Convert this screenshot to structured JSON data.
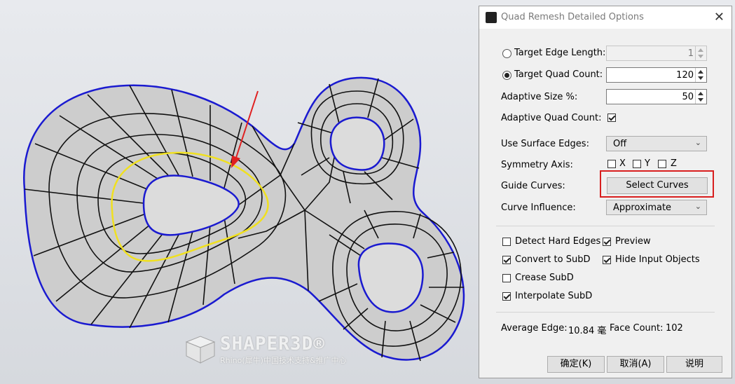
{
  "dialog": {
    "title": "Quad Remesh Detailed Options",
    "close_glyph": "✕",
    "target_edge_length": {
      "label": "Target Edge Length:",
      "value": "1",
      "selected": false
    },
    "target_quad_count": {
      "label": "Target Quad Count:",
      "value": "120",
      "selected": true
    },
    "adaptive_size": {
      "label": "Adaptive Size %:",
      "value": "50"
    },
    "adaptive_quad_count": {
      "label": "Adaptive Quad Count:",
      "checked": true
    },
    "use_surface_edges": {
      "label": "Use Surface Edges:",
      "value": "Off"
    },
    "symmetry_axis": {
      "label": "Symmetry Axis:",
      "x": "X",
      "y": "Y",
      "z": "Z"
    },
    "guide_curves": {
      "label": "Guide Curves:",
      "button": "Select Curves"
    },
    "curve_influence": {
      "label": "Curve Influence:",
      "value": "Approximate"
    },
    "options": {
      "detect_hard_edges": "Detect Hard Edges",
      "preview": "Preview",
      "convert_to_subd": "Convert to SubD",
      "hide_input_objects": "Hide Input Objects",
      "crease_subd": "Crease SubD",
      "interpolate_subd": "Interpolate SubD"
    },
    "stats": {
      "average_edge_label": "Average Edge:",
      "average_edge_value": "10.84 毫",
      "face_count_label": "Face Count:",
      "face_count_value": "102"
    },
    "buttons": {
      "ok": "确定(K)",
      "cancel": "取消(A)",
      "help": "说明"
    }
  },
  "watermark": {
    "brand": "SHAPER3D®",
    "subtitle": "Rhino(犀牛)中国技术支持&推广中心"
  },
  "colors": {
    "mesh_fill": "#cdcdcd",
    "boundary": "#1a1ad0",
    "guide_curve": "#f0e020",
    "arrow": "#e02020",
    "highlight": "#d81e1e"
  }
}
